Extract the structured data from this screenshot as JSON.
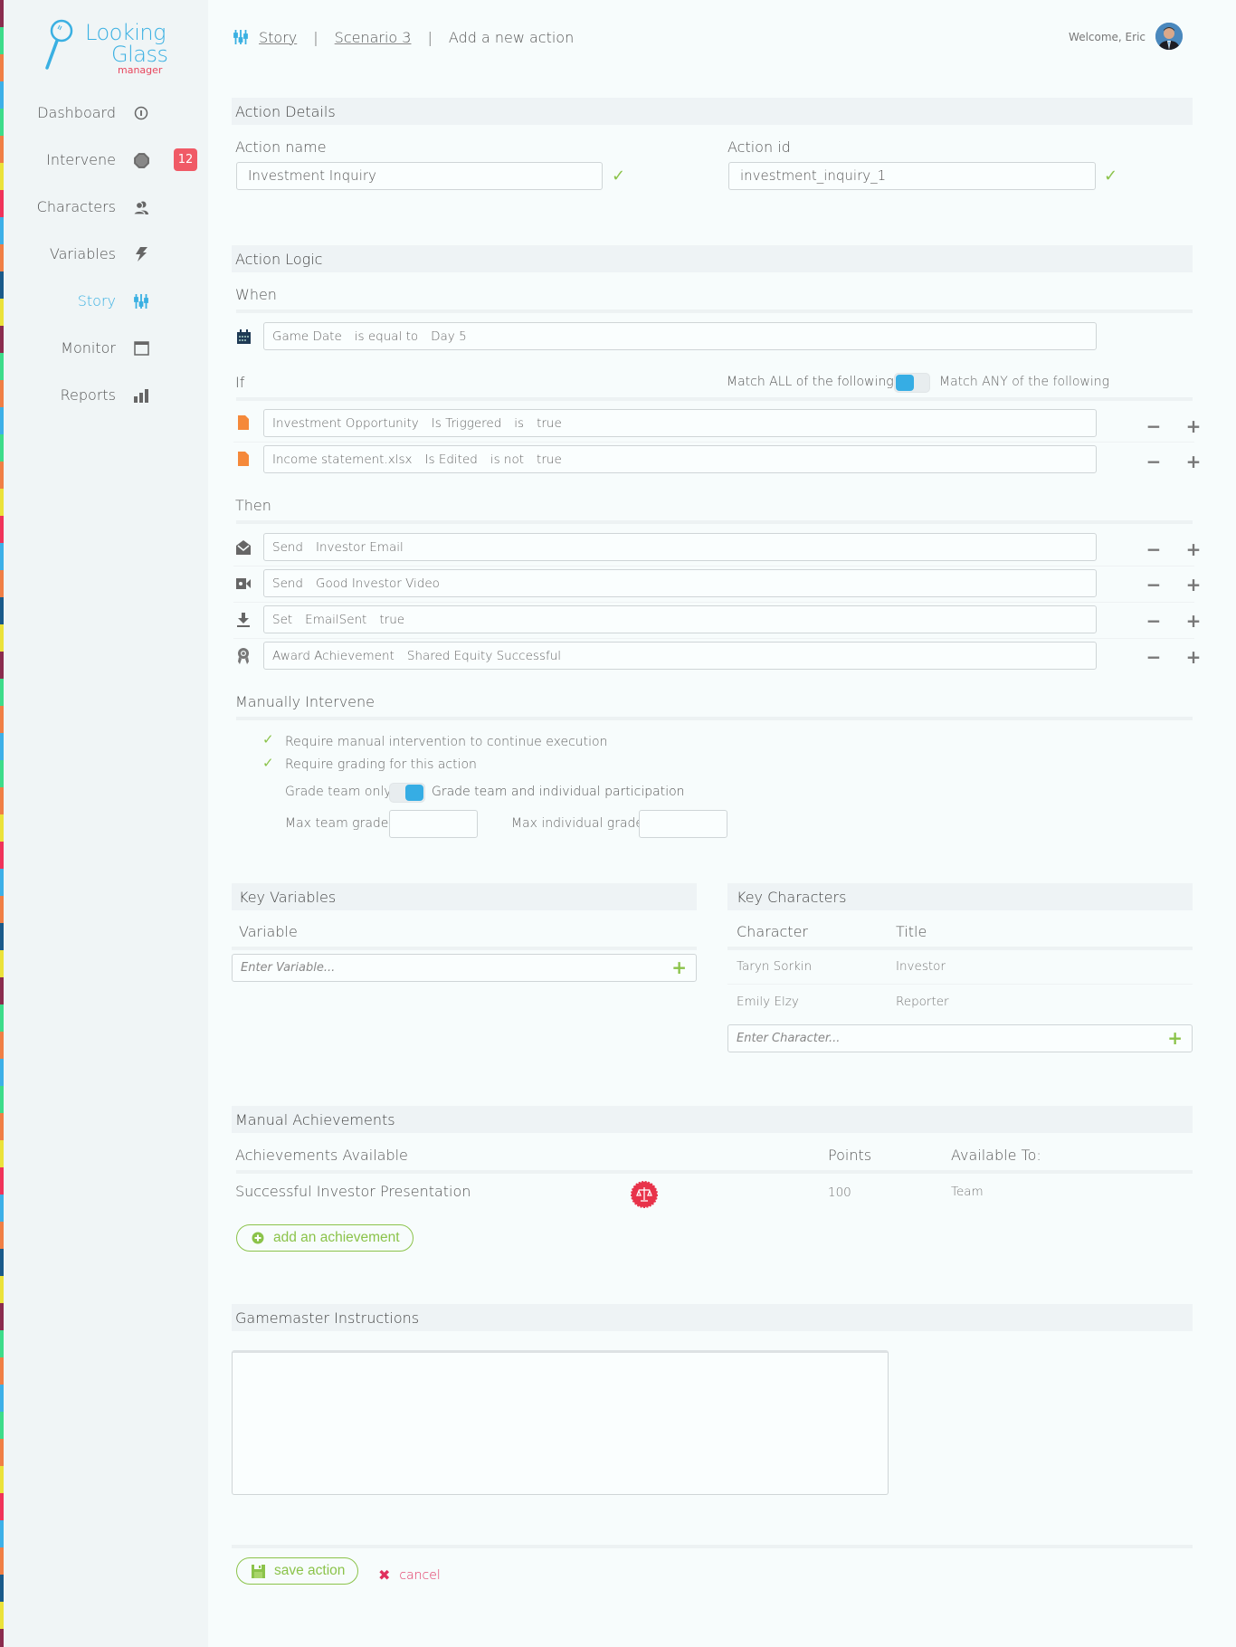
{
  "app": {
    "logo_line1": "Looking",
    "logo_line2": "Glass",
    "logo_line3": "manager"
  },
  "sidebar": {
    "items": [
      {
        "label": "Dashboard",
        "icon": "dashboard-gauge-icon"
      },
      {
        "label": "Intervene",
        "icon": "stop-octagon-icon",
        "badge": "12"
      },
      {
        "label": "Characters",
        "icon": "users-icon"
      },
      {
        "label": "Variables",
        "icon": "lightning-bolt-icon"
      },
      {
        "label": "Story",
        "icon": "sliders-icon",
        "active": true
      },
      {
        "label": "Monitor",
        "icon": "browser-window-icon"
      },
      {
        "label": "Reports",
        "icon": "bar-chart-icon"
      }
    ]
  },
  "header": {
    "breadcrumb": [
      "Story",
      "Scenario 3",
      "Add a new action"
    ],
    "welcome": "Welcome, Eric"
  },
  "action_details": {
    "title": "Action Details",
    "name_label": "Action name",
    "name_value": "Investment Inquiry",
    "id_label": "Action id",
    "id_value": "investment_inquiry_1"
  },
  "action_logic": {
    "title": "Action Logic",
    "when_label": "When",
    "when": [
      "Game Date",
      "is equal to",
      "Day 5"
    ],
    "if_label": "If",
    "match_all": "Match ALL of the following",
    "match_any": "Match ANY of the following",
    "match_mode": "ALL",
    "if_rows": [
      [
        "Investment Opportunity",
        "Is Triggered",
        "is",
        "true"
      ],
      [
        "Income statement.xlsx",
        "Is Edited",
        "is not",
        "true"
      ]
    ],
    "then_label": "Then",
    "then_rows": [
      {
        "icon": "envelope-open-icon",
        "parts": [
          "Send",
          "Investor Email"
        ]
      },
      {
        "icon": "video-camera-icon",
        "parts": [
          "Send",
          "Good Investor Video"
        ]
      },
      {
        "icon": "download-icon",
        "parts": [
          "Set",
          "EmailSent",
          "true"
        ]
      },
      {
        "icon": "award-ribbon-icon",
        "parts": [
          "Award Achievement",
          "Shared Equity Successful"
        ]
      }
    ]
  },
  "manual": {
    "title": "Manually Intervene",
    "opt1": "Require manual intervention to continue execution",
    "opt2": "Require grading for this action",
    "grade_team_only": "Grade team only",
    "grade_team_individual": "Grade team and individual participation",
    "grade_mode": "team and individual",
    "max_team_label": "Max team grade",
    "max_team_value": "",
    "max_individual_label": "Max individual grade",
    "max_individual_value": ""
  },
  "key_variables": {
    "title": "Key Variables",
    "column": "Variable",
    "placeholder": "Enter Variable..."
  },
  "key_characters": {
    "title": "Key Characters",
    "columns": [
      "Character",
      "Title"
    ],
    "rows": [
      [
        "Taryn Sorkin",
        "Investor"
      ],
      [
        "Emily Elzy",
        "Reporter"
      ]
    ],
    "placeholder": "Enter Character..."
  },
  "achievements": {
    "title": "Manual Achievements",
    "columns": [
      "Achievements Available",
      "Points",
      "Available To:"
    ],
    "rows": [
      {
        "name": "Successful Investor Presentation",
        "icon": "scales-badge-icon",
        "points": "100",
        "available_to": "Team"
      }
    ],
    "add_label": "add an achievement"
  },
  "gm": {
    "title": "Gamemaster Instructions",
    "value": ""
  },
  "footer": {
    "save_label": "save action",
    "cancel_label": "cancel"
  },
  "colors": {
    "accent": "#3ab0e2",
    "success": "#8bc34a",
    "danger": "#e0305e",
    "badge": "#f05a66"
  }
}
